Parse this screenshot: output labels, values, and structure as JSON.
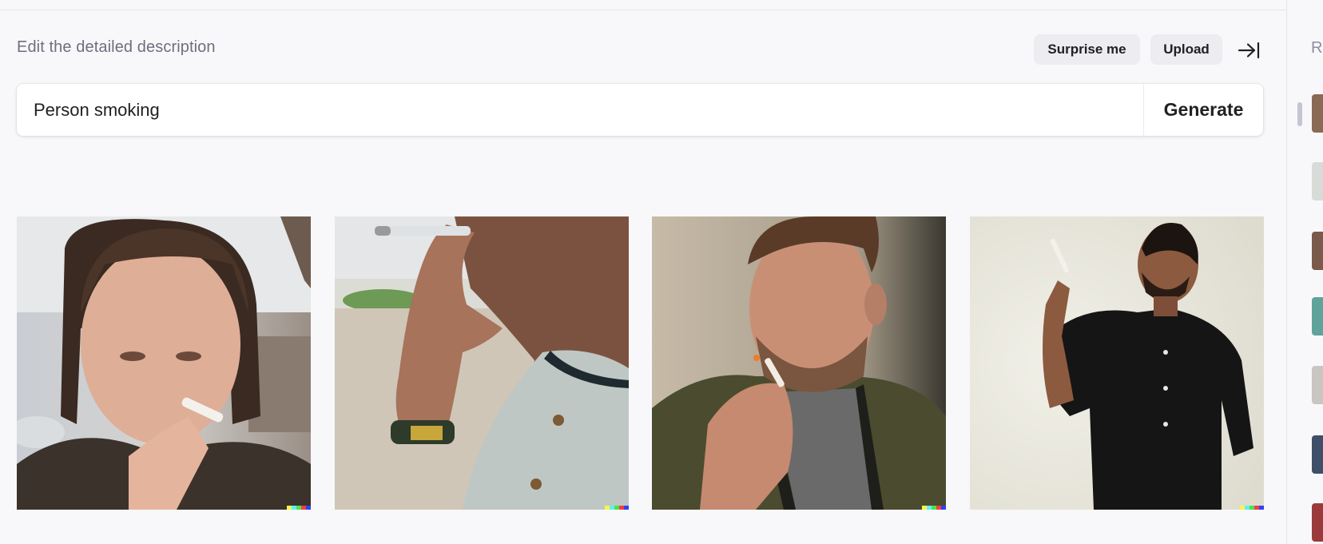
{
  "header": {
    "label": "Edit the detailed description",
    "surprise_label": "Surprise me",
    "upload_label": "Upload",
    "collapse_icon": "arrow-right-to-bar-icon"
  },
  "prompt": {
    "value": "Person smoking",
    "generate_label": "Generate"
  },
  "results": [
    {
      "name": "result-image-1",
      "subject": "woman with bangs smoking cigarette"
    },
    {
      "name": "result-image-2",
      "subject": "close-up of man holding cigarette to lips"
    },
    {
      "name": "result-image-3",
      "subject": "man in olive bomber jacket lighting cigarette"
    },
    {
      "name": "result-image-4",
      "subject": "man in black shirt holding cigarette up"
    }
  ],
  "watermark_colors": [
    "#fdf44a",
    "#5ef0ef",
    "#4fe053",
    "#f0413a",
    "#3340f4"
  ],
  "sidebar": {
    "title": "Recent",
    "thumbnails": 7
  },
  "colors": {
    "background": "#f8f8fa",
    "pill": "#ececf1",
    "text": "#202123",
    "muted": "#6e6e80"
  }
}
